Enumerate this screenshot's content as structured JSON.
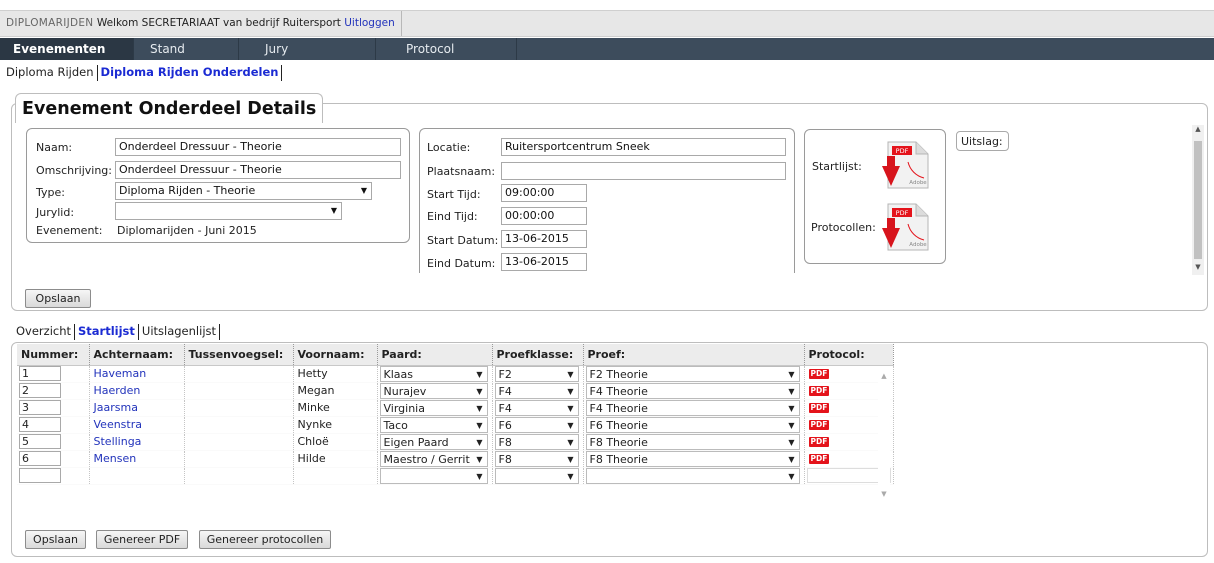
{
  "topbar": {
    "brand": "DIPLOMARIJDEN",
    "welcome": "Welkom SECRETARIAAT van bedrijf Ruitersport",
    "logout": "Uitloggen"
  },
  "nav": [
    "Evenementen",
    "Stand",
    "Jury",
    "Protocol"
  ],
  "subnav": [
    "Diploma Rijden",
    "Diploma Rijden Onderdelen"
  ],
  "details": {
    "title": "Evenement Onderdeel Details",
    "naam_label": "Naam:",
    "naam_value": "Onderdeel Dressuur - Theorie",
    "omschrijving_label": "Omschrijving:",
    "omschrijving_value": "Onderdeel Dressuur - Theorie",
    "type_label": "Type:",
    "type_value": "Diploma Rijden - Theorie",
    "jurylid_label": "Jurylid:",
    "jurylid_value": "",
    "evenement_label": "Evenement:",
    "evenement_value": "Diplomarijden - Juni 2015",
    "locatie_label": "Locatie:",
    "locatie_value": "Ruitersportcentrum Sneek",
    "plaatsnaam_label": "Plaatsnaam:",
    "plaatsnaam_value": "",
    "starttijd_label": "Start Tijd:",
    "starttijd_value": "09:00:00",
    "eindtijd_label": "Eind Tijd:",
    "eindtijd_value": "00:00:00",
    "startdatum_label": "Start Datum:",
    "startdatum_value": "13-06-2015",
    "einddatum_label": "Eind Datum:",
    "einddatum_value": "13-06-2015",
    "startlijst_label": "Startlijst:",
    "protocollen_label": "Protocollen:",
    "uitslag_label": "Uitslag:",
    "pdf_text": "PDF",
    "adobe_text": "Adobe",
    "save": "Opslaan"
  },
  "tabs": [
    "Overzicht",
    "Startlijst",
    "Uitslagenlijst"
  ],
  "table": {
    "headers": [
      "Nummer:",
      "Achternaam:",
      "Tussenvoegsel:",
      "Voornaam:",
      "Paard:",
      "Proefklasse:",
      "Proef:",
      "Protocol:"
    ],
    "rows": [
      {
        "nummer": "1",
        "achternaam": "Haveman",
        "tussenvoegsel": "",
        "voornaam": "Hetty",
        "paard": "Klaas",
        "klasse": "F2",
        "proef": "F2 Theorie",
        "protocol": "PDF"
      },
      {
        "nummer": "2",
        "achternaam": "Haerden",
        "tussenvoegsel": "",
        "voornaam": "Megan",
        "paard": "Nurajev",
        "klasse": "F4",
        "proef": "F4 Theorie",
        "protocol": "PDF"
      },
      {
        "nummer": "3",
        "achternaam": "Jaarsma",
        "tussenvoegsel": "",
        "voornaam": "Minke",
        "paard": "Virginia",
        "klasse": "F4",
        "proef": "F4 Theorie",
        "protocol": "PDF"
      },
      {
        "nummer": "4",
        "achternaam": "Veenstra",
        "tussenvoegsel": "",
        "voornaam": "Nynke",
        "paard": "Taco",
        "klasse": "F6",
        "proef": "F6 Theorie",
        "protocol": "PDF"
      },
      {
        "nummer": "5",
        "achternaam": "Stellinga",
        "tussenvoegsel": "",
        "voornaam": "Chloë",
        "paard": "Eigen Paard",
        "klasse": "F8",
        "proef": "F8 Theorie",
        "protocol": "PDF"
      },
      {
        "nummer": "6",
        "achternaam": "Mensen",
        "tussenvoegsel": "",
        "voornaam": "Hilde",
        "paard": "Maestro / Gerrit",
        "klasse": "F8",
        "proef": "F8 Theorie",
        "protocol": "PDF"
      },
      {
        "nummer": "",
        "achternaam": "",
        "tussenvoegsel": "",
        "voornaam": "",
        "paard": "",
        "klasse": "",
        "proef": "",
        "protocol": ""
      }
    ]
  },
  "buttons": {
    "save": "Opslaan",
    "generate_pdf": "Genereer PDF",
    "generate_protocols": "Genereer protocollen"
  },
  "colors": {
    "nav_bg": "#3d4c5c",
    "nav_active": "#2b3744",
    "link": "#2233bb",
    "pdf_red": "#e4131b"
  }
}
